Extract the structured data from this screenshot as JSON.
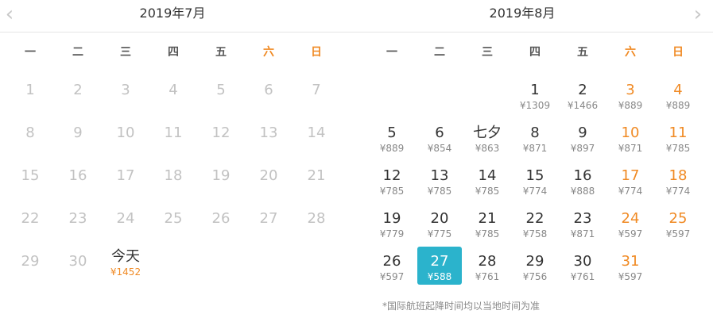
{
  "nav": {
    "prev_icon": "chevron-left-icon",
    "next_icon": "chevron-right-icon",
    "prev_glyph": "‹",
    "next_glyph": "›"
  },
  "colors": {
    "weekend": "#f08a24",
    "selected": "#2bb3cc",
    "disabled": "#c2c2c2"
  },
  "weekdays": [
    "一",
    "二",
    "三",
    "四",
    "五",
    "六",
    "日"
  ],
  "months": [
    {
      "title": "2019年7月",
      "days": [
        {
          "d": "1",
          "s": "past"
        },
        {
          "d": "2",
          "s": "past"
        },
        {
          "d": "3",
          "s": "past"
        },
        {
          "d": "4",
          "s": "past"
        },
        {
          "d": "5",
          "s": "past"
        },
        {
          "d": "6",
          "s": "past"
        },
        {
          "d": "7",
          "s": "past"
        },
        {
          "d": "8",
          "s": "past"
        },
        {
          "d": "9",
          "s": "past"
        },
        {
          "d": "10",
          "s": "past"
        },
        {
          "d": "11",
          "s": "past"
        },
        {
          "d": "12",
          "s": "past"
        },
        {
          "d": "13",
          "s": "past"
        },
        {
          "d": "14",
          "s": "past"
        },
        {
          "d": "15",
          "s": "past"
        },
        {
          "d": "16",
          "s": "past"
        },
        {
          "d": "17",
          "s": "past"
        },
        {
          "d": "18",
          "s": "past"
        },
        {
          "d": "19",
          "s": "past"
        },
        {
          "d": "20",
          "s": "past"
        },
        {
          "d": "21",
          "s": "past"
        },
        {
          "d": "22",
          "s": "past"
        },
        {
          "d": "23",
          "s": "past"
        },
        {
          "d": "24",
          "s": "past"
        },
        {
          "d": "25",
          "s": "past"
        },
        {
          "d": "26",
          "s": "past"
        },
        {
          "d": "27",
          "s": "past"
        },
        {
          "d": "28",
          "s": "past"
        },
        {
          "d": "29",
          "s": "past"
        },
        {
          "d": "30",
          "s": "past"
        },
        {
          "d": "今天",
          "p": "¥1452",
          "s": "today"
        }
      ]
    },
    {
      "title": "2019年8月",
      "days": [
        {
          "d": "1",
          "p": "¥1309"
        },
        {
          "d": "2",
          "p": "¥1466"
        },
        {
          "d": "3",
          "p": "¥889"
        },
        {
          "d": "4",
          "p": "¥889"
        },
        {
          "d": "5",
          "p": "¥889"
        },
        {
          "d": "6",
          "p": "¥854"
        },
        {
          "d": "七夕",
          "p": "¥863"
        },
        {
          "d": "8",
          "p": "¥871"
        },
        {
          "d": "9",
          "p": "¥897"
        },
        {
          "d": "10",
          "p": "¥871"
        },
        {
          "d": "11",
          "p": "¥785"
        },
        {
          "d": "12",
          "p": "¥785"
        },
        {
          "d": "13",
          "p": "¥785"
        },
        {
          "d": "14",
          "p": "¥785"
        },
        {
          "d": "15",
          "p": "¥774"
        },
        {
          "d": "16",
          "p": "¥888"
        },
        {
          "d": "17",
          "p": "¥774"
        },
        {
          "d": "18",
          "p": "¥774"
        },
        {
          "d": "19",
          "p": "¥779"
        },
        {
          "d": "20",
          "p": "¥775"
        },
        {
          "d": "21",
          "p": "¥785"
        },
        {
          "d": "22",
          "p": "¥758"
        },
        {
          "d": "23",
          "p": "¥871"
        },
        {
          "d": "24",
          "p": "¥597"
        },
        {
          "d": "25",
          "p": "¥597"
        },
        {
          "d": "26",
          "p": "¥597"
        },
        {
          "d": "27",
          "p": "¥588",
          "s": "selected"
        },
        {
          "d": "28",
          "p": "¥761"
        },
        {
          "d": "29",
          "p": "¥756"
        },
        {
          "d": "30",
          "p": "¥761"
        },
        {
          "d": "31",
          "p": "¥597"
        }
      ]
    }
  ],
  "footnote": "*国际航班起降时间均以当地时间为准"
}
